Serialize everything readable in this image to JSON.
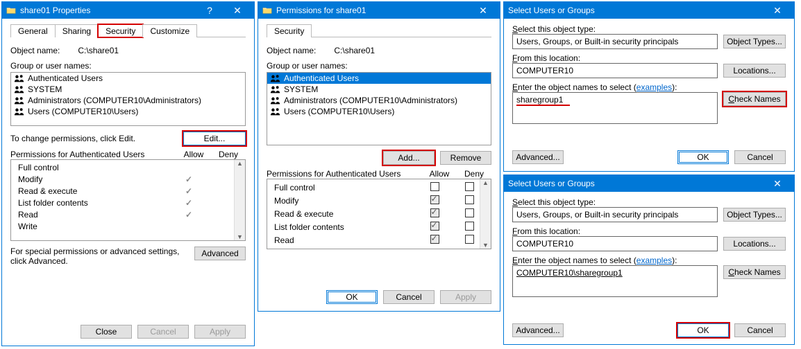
{
  "dialog1": {
    "title": "share01 Properties",
    "tabs": [
      "General",
      "Sharing",
      "Security",
      "Customize"
    ],
    "activeTab": "Security",
    "objectNameLabel": "Object name:",
    "objectName": "C:\\share01",
    "groupLabel": "Group or user names:",
    "items": [
      "Authenticated Users",
      "SYSTEM",
      "Administrators (COMPUTER10\\Administrators)",
      "Users (COMPUTER10\\Users)"
    ],
    "changeHint": "To change permissions, click Edit.",
    "editBtn": "Edit...",
    "permHeader": "Permissions for Authenticated Users",
    "allow": "Allow",
    "deny": "Deny",
    "perms": [
      "Full control",
      "Modify",
      "Read & execute",
      "List folder contents",
      "Read",
      "Write"
    ],
    "checks": [
      false,
      true,
      true,
      true,
      true,
      false
    ],
    "advHint": "For special permissions or advanced settings, click Advanced.",
    "advanced": "Advanced",
    "close": "Close",
    "cancel": "Cancel",
    "apply": "Apply"
  },
  "dialog2": {
    "title": "Permissions for share01",
    "tab": "Security",
    "objectNameLabel": "Object name:",
    "objectName": "C:\\share01",
    "groupLabel": "Group or user names:",
    "items": [
      "Authenticated Users",
      "SYSTEM",
      "Administrators (COMPUTER10\\Administrators)",
      "Users (COMPUTER10\\Users)"
    ],
    "selected": 0,
    "add": "Add...",
    "remove": "Remove",
    "permHeader": "Permissions for Authenticated Users",
    "allow": "Allow",
    "deny": "Deny",
    "perms": [
      "Full control",
      "Modify",
      "Read & execute",
      "List folder contents",
      "Read"
    ],
    "allowChecks": [
      false,
      true,
      true,
      true,
      true
    ],
    "ok": "OK",
    "cancel": "Cancel",
    "apply": "Apply"
  },
  "dialog3": {
    "title": "Select Users or Groups",
    "objTypeLabel": "Select this object type:",
    "objType": "Users, Groups, or Built-in security principals",
    "objectTypesBtn": "Object Types...",
    "fromLabel": "From this location:",
    "from": "COMPUTER10",
    "locationsBtn": "Locations...",
    "enterLabel_prefix": "Enter the object names to select (",
    "examples": "examples",
    "enterLabel_suffix": "):",
    "entered": "sharegroup1",
    "checkNames": "Check Names",
    "advanced": "Advanced...",
    "ok": "OK",
    "cancel": "Cancel"
  },
  "dialog4": {
    "title": "Select Users or Groups",
    "objTypeLabel": "Select this object type:",
    "objType": "Users, Groups, or Built-in security principals",
    "objectTypesBtn": "Object Types...",
    "fromLabel": "From this location:",
    "from": "COMPUTER10",
    "locationsBtn": "Locations...",
    "enterLabel_prefix": "Enter the object names to select (",
    "examples": "examples",
    "enterLabel_suffix": "):",
    "entered": "COMPUTER10\\sharegroup1",
    "checkNames": "Check Names",
    "advanced": "Advanced...",
    "ok": "OK",
    "cancel": "Cancel"
  }
}
